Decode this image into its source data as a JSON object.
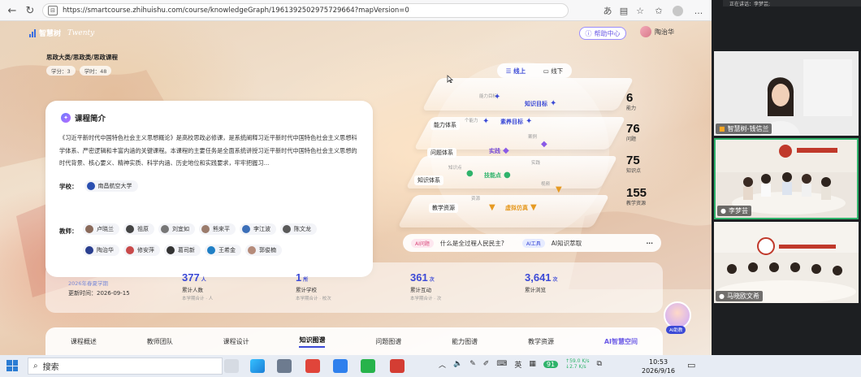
{
  "browser": {
    "url": "https://smartcourse.zhihuishu.com/course/knowledgeGraph/1961392502975729664?mapVersion=0",
    "more": "..."
  },
  "header": {
    "logo_text": "智慧树",
    "logo_sub": "Twenty",
    "help_center": "帮助中心",
    "user_name": "陶治华"
  },
  "course": {
    "breadcrumb": "思政大类/思政类/思政课程",
    "credit": "学分：3",
    "hours": "学时：48",
    "intro_title": "课程简介",
    "intro_text": "《习近平新时代中国特色社会主义思想概论》是高校思政必修课，是系统阐释习近平新时代中国特色社会主义思想科学体系、严密逻辑和丰富内涵的关键课程。本课程的主要任务是全面系统讲授习近平新时代中国特色社会主义思想的时代背景、核心要义、精神实质、科学内涵、历史地位和实践要求，牢牢把握习...",
    "school_label": "学校：",
    "school_name": "南昌航空大学",
    "teachers_label": "教师：",
    "teachers_row1": [
      "卢晓兰",
      "祖原",
      "刘宜如",
      "熊来平",
      "李江波",
      "陈文龙"
    ],
    "teachers_row2": [
      "陶治华",
      "修安萍",
      "葛司新",
      "王希金",
      "郭俊楠"
    ]
  },
  "graph": {
    "toggle_online": "线上",
    "toggle_offline": "线下",
    "layers": [
      "能力体系",
      "问题体系",
      "知识体系",
      "教学资源"
    ],
    "nodes": [
      "知识目标",
      "素养目标",
      "实践",
      "技能点",
      "虚拟仿真"
    ],
    "small_nodes": [
      "能力目标",
      "个能力",
      "实践",
      "知识点",
      "案例",
      "资源",
      "视频"
    ]
  },
  "stats": [
    {
      "value": "6",
      "label": "能力"
    },
    {
      "value": "76",
      "label": "问题"
    },
    {
      "value": "75",
      "label": "知识点"
    },
    {
      "value": "155",
      "label": "教学资源"
    }
  ],
  "ai_bar": {
    "tag1": "AI问题",
    "question": "什么是全过程人民民主?",
    "tag2": "AI工具",
    "tool": "AI知识萃取",
    "more": "···"
  },
  "summary": {
    "term": "2026年春夏学期",
    "updated": "更新时间：2026-09-15",
    "items": [
      {
        "value": "377",
        "unit": "人",
        "label": "累计人数",
        "note": "本学期合计 · 人"
      },
      {
        "value": "1",
        "unit": "所",
        "label": "累计学校",
        "note": "本学期合计 · 校次"
      },
      {
        "value": "361",
        "unit": "次",
        "label": "累计互动",
        "note": "本学期合计 · 次"
      },
      {
        "value": "3,641",
        "unit": "次",
        "label": "累计浏览",
        "note": ""
      }
    ]
  },
  "ai_assistant": "AI助教",
  "tabs": [
    "课程概述",
    "教师团队",
    "课程设计",
    "知识图谱",
    "问题图谱",
    "能力图谱",
    "教学资源",
    "AI智慧空间"
  ],
  "active_tab": "知识图谱",
  "video": {
    "top_caption": "正在讲话：李梦芸;",
    "tiles": [
      "智慧树-钱信兰",
      "李梦芸",
      "马晓欧文希"
    ]
  },
  "taskbar": {
    "search": "搜索",
    "ime": "英",
    "badge": "91",
    "net_up": "59.0",
    "net_down": "2.7",
    "net_unit": "K/s",
    "time": "10:53",
    "date": "2026/9/16"
  },
  "colors": {
    "accent": "#3b49d6",
    "purple": "#6b5ae6",
    "green": "#2fb36b"
  }
}
